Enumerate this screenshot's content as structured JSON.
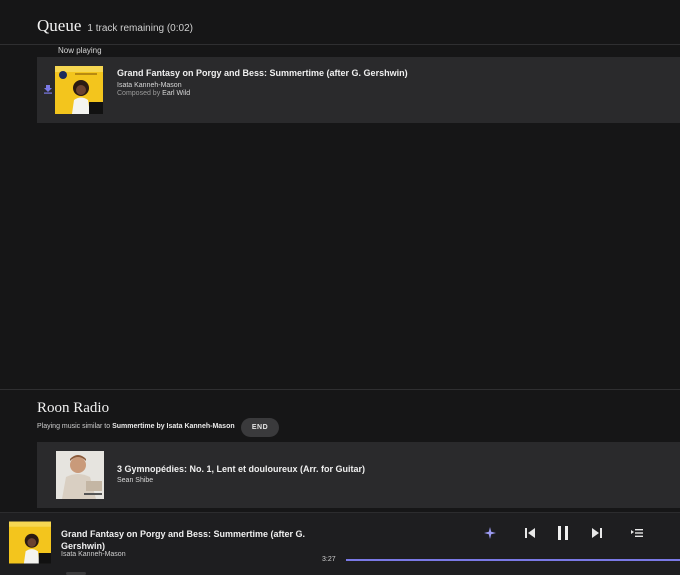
{
  "queue": {
    "title": "Queue",
    "remaining": "1 track remaining (0:02)",
    "now_playing_label": "Now playing",
    "tracks": [
      {
        "title": "Grand Fantasy on Porgy and Bess: Summertime (after G. Gershwin)",
        "artist": "Isata Kanneh-Mason",
        "composed_by_label": "Composed by",
        "composer": "Earl Wild"
      }
    ]
  },
  "radio": {
    "title": "Roon Radio",
    "desc_prefix": "Playing music similar to",
    "desc_subject": "Summertime by Isata Kanneh-Mason",
    "end_label": "END",
    "tracks": [
      {
        "title": "3 Gymnopédies: No. 1, Lent et douloureux (Arr. for Guitar)",
        "artist": "Sean Shibe"
      }
    ]
  },
  "player": {
    "title": "Grand Fantasy on Porgy and Bess: Summertime (after G. Gershwin)",
    "artist": "Isata Kanneh-Mason",
    "elapsed": "3:27",
    "progress": 1.0
  },
  "colors": {
    "background": "#161617",
    "row": "#2a2a2c",
    "accent": "#7a79e6"
  }
}
